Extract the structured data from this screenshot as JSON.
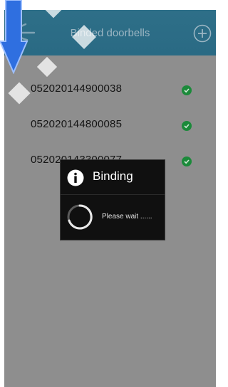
{
  "header": {
    "title": "Binded doorbells"
  },
  "doorbells": [
    {
      "serial": "052020144900038"
    },
    {
      "serial": "052020144800085"
    },
    {
      "serial": "052020143300077"
    }
  ],
  "dialog": {
    "title": "Binding",
    "message": "Please wait ......"
  },
  "icons": {
    "back": "back-arrow-icon",
    "add": "plus-circle-icon",
    "status": "check-circle-icon",
    "info": "info-icon",
    "spinner": "loading-spinner-icon"
  },
  "colors": {
    "header": "#2e6f88",
    "overlay": "#8e8e8e",
    "status_ok": "#1b8a3a",
    "dialog_bg": "#101010"
  }
}
